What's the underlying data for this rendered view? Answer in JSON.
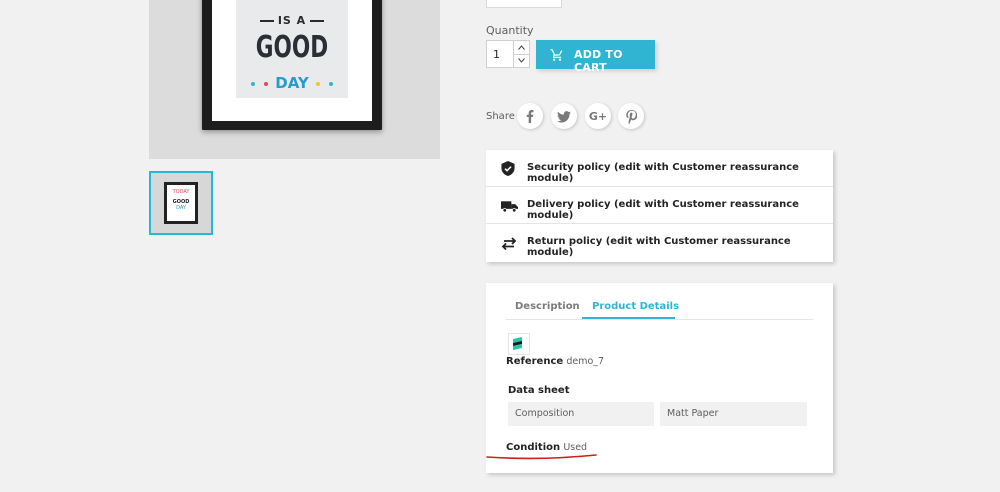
{
  "product_image": {
    "poster_line1": "IS A",
    "poster_line2": "GOOD",
    "poster_line3": "DAY",
    "thumb_line1": "TODAY",
    "thumb_line2": "GOOD",
    "thumb_line3": "DAY"
  },
  "quantity": {
    "label": "Quantity",
    "value": "1",
    "up_icon": "chevron-up-icon",
    "down_icon": "chevron-down-icon"
  },
  "cart": {
    "label": "ADD TO CART",
    "icon": "shopping-cart-icon"
  },
  "share": {
    "label": "Share",
    "buttons": [
      {
        "name": "facebook-icon",
        "glyph": "f"
      },
      {
        "name": "twitter-icon",
        "glyph": "t"
      },
      {
        "name": "google-plus-icon",
        "glyph": "G+"
      },
      {
        "name": "pinterest-icon",
        "glyph": "P"
      }
    ]
  },
  "reassurance": {
    "items": [
      {
        "icon": "shield-check-icon",
        "label": "Security policy (edit with Customer reassurance module)"
      },
      {
        "icon": "truck-icon",
        "label": "Delivery policy (edit with Customer reassurance module)"
      },
      {
        "icon": "swap-arrows-icon",
        "label": "Return policy (edit with Customer reassurance module)"
      }
    ]
  },
  "tabs": {
    "description": "Description",
    "details": "Product Details",
    "active": "Product Details"
  },
  "details": {
    "reference_label": "Reference",
    "reference_value": "demo_7",
    "datasheet_title": "Data sheet",
    "datasheet": [
      {
        "name": "Composition",
        "value": "Matt Paper"
      }
    ],
    "condition_label": "Condition",
    "condition_value": "Used"
  },
  "colors": {
    "accent": "#2fb5d2",
    "background": "#f1f1f1",
    "annotation": "#d31d1d"
  }
}
